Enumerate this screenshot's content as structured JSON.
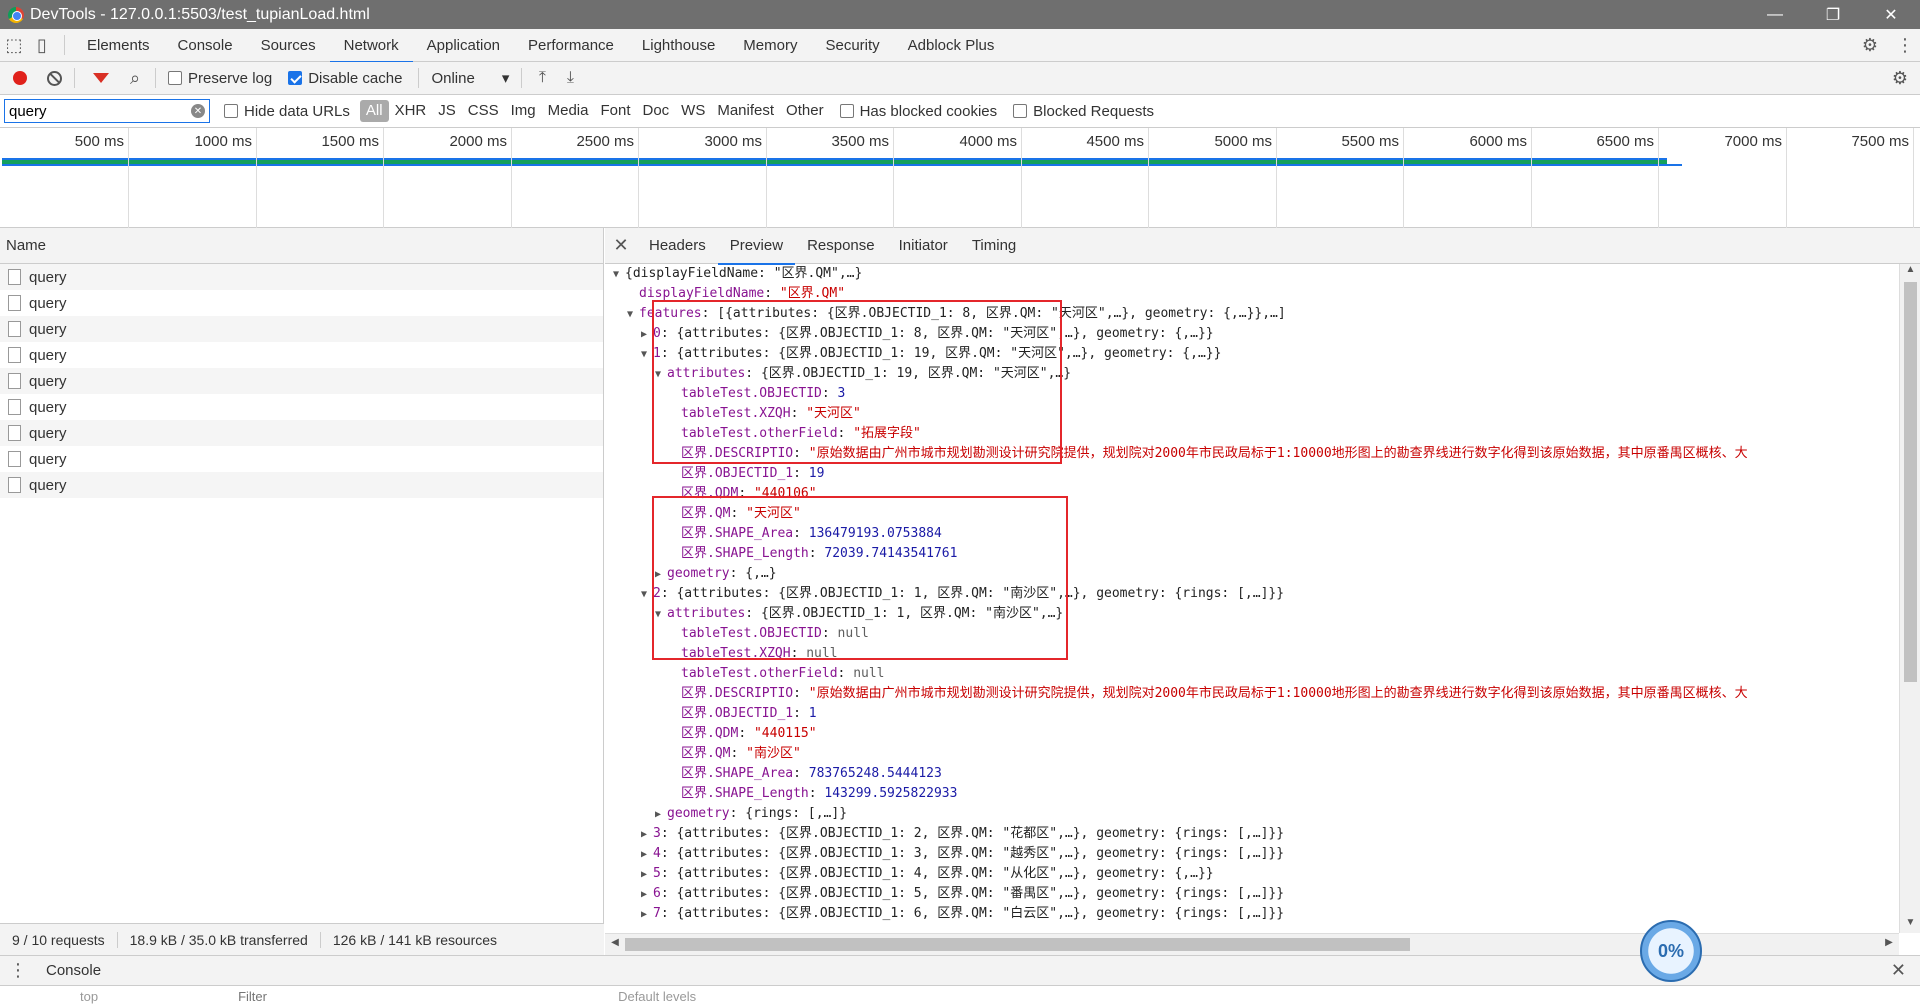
{
  "window": {
    "title": "DevTools - 127.0.0.1:5503/test_tupianLoad.html",
    "controls": [
      "—",
      "❐",
      "✕"
    ]
  },
  "tabs": [
    "Elements",
    "Console",
    "Sources",
    "Network",
    "Application",
    "Performance",
    "Lighthouse",
    "Memory",
    "Security",
    "Adblock Plus"
  ],
  "toolbar": {
    "preserve_log": "Preserve log",
    "disable_cache": "Disable cache",
    "throttle": "Online"
  },
  "filter": {
    "value": "query",
    "hide_data_urls": "Hide data URLs",
    "types": [
      "All",
      "XHR",
      "JS",
      "CSS",
      "Img",
      "Media",
      "Font",
      "Doc",
      "WS",
      "Manifest",
      "Other"
    ],
    "has_blocked_cookies": "Has blocked cookies",
    "blocked_requests": "Blocked Requests"
  },
  "timeline": {
    "ticks": [
      "500 ms",
      "1000 ms",
      "1500 ms",
      "2000 ms",
      "2500 ms",
      "3000 ms",
      "3500 ms",
      "4000 ms",
      "4500 ms",
      "5000 ms",
      "5500 ms",
      "6000 ms",
      "6500 ms",
      "7000 ms",
      "7500 ms"
    ]
  },
  "requests": {
    "header": "Name",
    "items": [
      "query",
      "query",
      "query",
      "query",
      "query",
      "query",
      "query",
      "query",
      "query"
    ],
    "status": [
      "9 / 10 requests",
      "18.9 kB / 35.0 kB transferred",
      "126 kB / 141 kB resources"
    ]
  },
  "preview": {
    "tabs": [
      "Headers",
      "Preview",
      "Response",
      "Initiator",
      "Timing"
    ],
    "lines": [
      {
        "i": 0,
        "t": "▼",
        "k": "",
        "v": "{displayFieldName: \"区界.QM\",…}",
        "c": "p"
      },
      {
        "i": 1,
        "t": "",
        "k": "displayFieldName",
        "v": "\"区界.QM\"",
        "c": "s"
      },
      {
        "i": 1,
        "t": "▼",
        "k": "features",
        "v": "[{attributes: {区界.OBJECTID_1: 8, 区界.QM: \"天河区\",…}, geometry: {,…}},…]",
        "c": "p"
      },
      {
        "i": 2,
        "t": "▶",
        "k": "0",
        "v": "{attributes: {区界.OBJECTID_1: 8, 区界.QM: \"天河区\",…}, geometry: {,…}}",
        "c": "p"
      },
      {
        "i": 2,
        "t": "▼",
        "k": "1",
        "v": "{attributes: {区界.OBJECTID_1: 19, 区界.QM: \"天河区\",…}, geometry: {,…}}",
        "c": "p"
      },
      {
        "i": 3,
        "t": "▼",
        "k": "attributes",
        "v": "{区界.OBJECTID_1: 19, 区界.QM: \"天河区\",…}",
        "c": "p"
      },
      {
        "i": 4,
        "t": "",
        "k": "tableTest.OBJECTID",
        "v": "3",
        "c": "n"
      },
      {
        "i": 4,
        "t": "",
        "k": "tableTest.XZQH",
        "v": "\"天河区\"",
        "c": "s"
      },
      {
        "i": 4,
        "t": "",
        "k": "tableTest.otherField",
        "v": "\"拓展字段\"",
        "c": "s"
      },
      {
        "i": 4,
        "t": "",
        "k": "区界.DESCRIPTIO",
        "v": "\"原始数据由广州市城市规划勘测设计研究院提供，规划院对2000年市民政局标于1:10000地形图上的勘查界线进行数字化得到该原始数据，其中原番禺区概核、大",
        "c": "s"
      },
      {
        "i": 4,
        "t": "",
        "k": "区界.OBJECTID_1",
        "v": "19",
        "c": "n"
      },
      {
        "i": 4,
        "t": "",
        "k": "区界.QDM",
        "v": "\"440106\"",
        "c": "s"
      },
      {
        "i": 4,
        "t": "",
        "k": "区界.QM",
        "v": "\"天河区\"",
        "c": "s"
      },
      {
        "i": 4,
        "t": "",
        "k": "区界.SHAPE_Area",
        "v": "136479193.0753884",
        "c": "n"
      },
      {
        "i": 4,
        "t": "",
        "k": "区界.SHAPE_Length",
        "v": "72039.74143541761",
        "c": "n"
      },
      {
        "i": 3,
        "t": "▶",
        "k": "geometry",
        "v": "{,…}",
        "c": "p"
      },
      {
        "i": 2,
        "t": "▼",
        "k": "2",
        "v": "{attributes: {区界.OBJECTID_1: 1, 区界.QM: \"南沙区\",…}, geometry: {rings: [,…]}}",
        "c": "p"
      },
      {
        "i": 3,
        "t": "▼",
        "k": "attributes",
        "v": "{区界.OBJECTID_1: 1, 区界.QM: \"南沙区\",…}",
        "c": "p"
      },
      {
        "i": 4,
        "t": "",
        "k": "tableTest.OBJECTID",
        "v": "null",
        "c": "nul"
      },
      {
        "i": 4,
        "t": "",
        "k": "tableTest.XZQH",
        "v": "null",
        "c": "nul"
      },
      {
        "i": 4,
        "t": "",
        "k": "tableTest.otherField",
        "v": "null",
        "c": "nul"
      },
      {
        "i": 4,
        "t": "",
        "k": "区界.DESCRIPTIO",
        "v": "\"原始数据由广州市城市规划勘测设计研究院提供，规划院对2000年市民政局标于1:10000地形图上的勘查界线进行数字化得到该原始数据，其中原番禺区概核、大",
        "c": "s"
      },
      {
        "i": 4,
        "t": "",
        "k": "区界.OBJECTID_1",
        "v": "1",
        "c": "n"
      },
      {
        "i": 4,
        "t": "",
        "k": "区界.QDM",
        "v": "\"440115\"",
        "c": "s"
      },
      {
        "i": 4,
        "t": "",
        "k": "区界.QM",
        "v": "\"南沙区\"",
        "c": "s"
      },
      {
        "i": 4,
        "t": "",
        "k": "区界.SHAPE_Area",
        "v": "783765248.5444123",
        "c": "n"
      },
      {
        "i": 4,
        "t": "",
        "k": "区界.SHAPE_Length",
        "v": "143299.5925822933",
        "c": "n"
      },
      {
        "i": 3,
        "t": "▶",
        "k": "geometry",
        "v": "{rings: [,…]}",
        "c": "p"
      },
      {
        "i": 2,
        "t": "▶",
        "k": "3",
        "v": "{attributes: {区界.OBJECTID_1: 2, 区界.QM: \"花都区\",…}, geometry: {rings: [,…]}}",
        "c": "p"
      },
      {
        "i": 2,
        "t": "▶",
        "k": "4",
        "v": "{attributes: {区界.OBJECTID_1: 3, 区界.QM: \"越秀区\",…}, geometry: {rings: [,…]}}",
        "c": "p"
      },
      {
        "i": 2,
        "t": "▶",
        "k": "5",
        "v": "{attributes: {区界.OBJECTID_1: 4, 区界.QM: \"从化区\",…}, geometry: {,…}}",
        "c": "p"
      },
      {
        "i": 2,
        "t": "▶",
        "k": "6",
        "v": "{attributes: {区界.OBJECTID_1: 5, 区界.QM: \"番禺区\",…}, geometry: {rings: [,…]}}",
        "c": "p"
      },
      {
        "i": 2,
        "t": "▶",
        "k": "7",
        "v": "{attributes: {区界.OBJECTID_1: 6, 区界.QM: \"白云区\",…}, geometry: {rings: [,…]}}",
        "c": "p"
      }
    ]
  },
  "drawer": {
    "tab": "Console",
    "filter_placeholder": "Filter",
    "context": "top",
    "levels": "Default levels"
  },
  "badge": "0%",
  "colors": {
    "accent": "#1a73e8",
    "record": "#e0211b",
    "highlight_box": "#e4262b"
  }
}
